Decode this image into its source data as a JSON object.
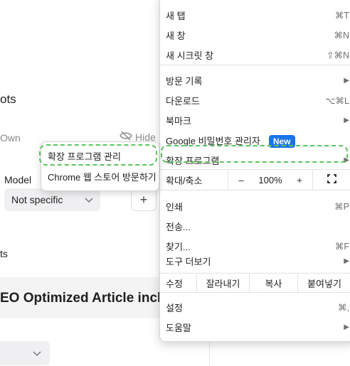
{
  "background": {
    "heading_fragment": "ots",
    "own_label": "Own",
    "hide_label": "Hide",
    "model_label": "Model",
    "model_select_value": "Not specific",
    "add_button_label": "+",
    "ts_fragment": "ts",
    "article_title_fragment": "EO Optimized Article inclu"
  },
  "menu": {
    "new_tab": {
      "label": "새 탭",
      "shortcut": "⌘T"
    },
    "new_window": {
      "label": "새 창",
      "shortcut": "⌘N"
    },
    "new_incognito": {
      "label": "새 시크릿 창",
      "shortcut": "⇧⌘N"
    },
    "history": {
      "label": "방문 기록"
    },
    "downloads": {
      "label": "다운로드",
      "shortcut": "⌥⌘L"
    },
    "bookmarks": {
      "label": "북마크"
    },
    "password_manager": {
      "label": "Google 비밀번호 관리자",
      "badge": "New"
    },
    "extensions": {
      "label": "확장 프로그램"
    },
    "zoom": {
      "label": "확대/축소",
      "minus": "–",
      "value": "100%",
      "plus": "+"
    },
    "print": {
      "label": "인쇄",
      "shortcut": "⌘P"
    },
    "cast": {
      "label": "전송..."
    },
    "find": {
      "label": "찾기...",
      "shortcut": "⌘F"
    },
    "more_tools": {
      "label": "도구 더보기"
    },
    "edit": {
      "label": "수정",
      "cut": "잘라내기",
      "copy": "복사",
      "paste": "붙여넣기"
    },
    "settings": {
      "label": "설정",
      "shortcut": "⌘,"
    },
    "help": {
      "label": "도움말"
    }
  },
  "submenu": {
    "manage_extensions": "확장 프로그램 관리",
    "visit_store": "Chrome 웹 스토어 방문하기"
  },
  "colors": {
    "highlight_dashed": "#5cc45c",
    "badge_blue": "#1a73e8"
  },
  "icons": {
    "submenu_arrow": "chevron-right-icon",
    "fullscreen": "fullscreen-icon",
    "hide": "eye-off-icon",
    "select_chevron": "chevron-down-icon"
  }
}
